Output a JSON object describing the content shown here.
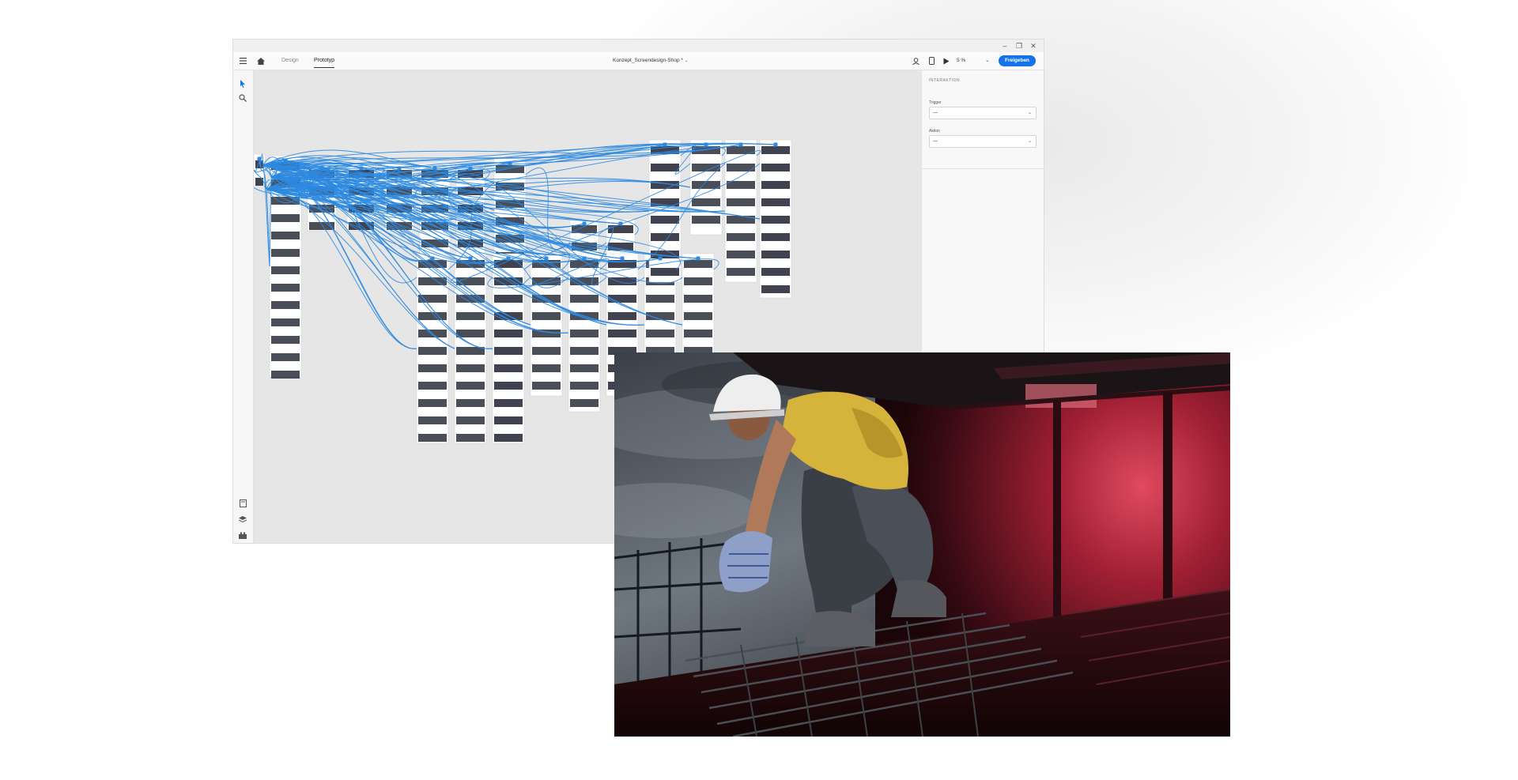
{
  "app": {
    "tabs": [
      {
        "label": "Design",
        "active": false
      },
      {
        "label": "Prototyp",
        "active": true
      }
    ],
    "document_title": "Konzept_Screendesign-Shop *",
    "zoom": "5 %",
    "share_label": "Freigeben",
    "window_controls": [
      "–",
      "❐",
      "✕"
    ]
  },
  "inspector": {
    "title": "INTERAKTION",
    "trigger_label": "Trigger",
    "trigger_value": "—",
    "action_label": "Aktion",
    "action_value": "—"
  },
  "colors": {
    "accent": "#1473e6",
    "wire": "#2d8ae0",
    "canvas": "#e6e6e6"
  },
  "icons": {
    "menu": "hamburger-icon",
    "home": "home-icon",
    "select": "pointer-icon",
    "zoom": "magnifier-icon",
    "user": "user-icon",
    "device": "mobile-preview-icon",
    "play": "play-icon",
    "dropdown": "chevron-down-icon",
    "assets": "assets-icon",
    "layers": "layers-icon",
    "plugins": "plugins-icon"
  },
  "photo": {
    "subject": "construction-worker"
  }
}
